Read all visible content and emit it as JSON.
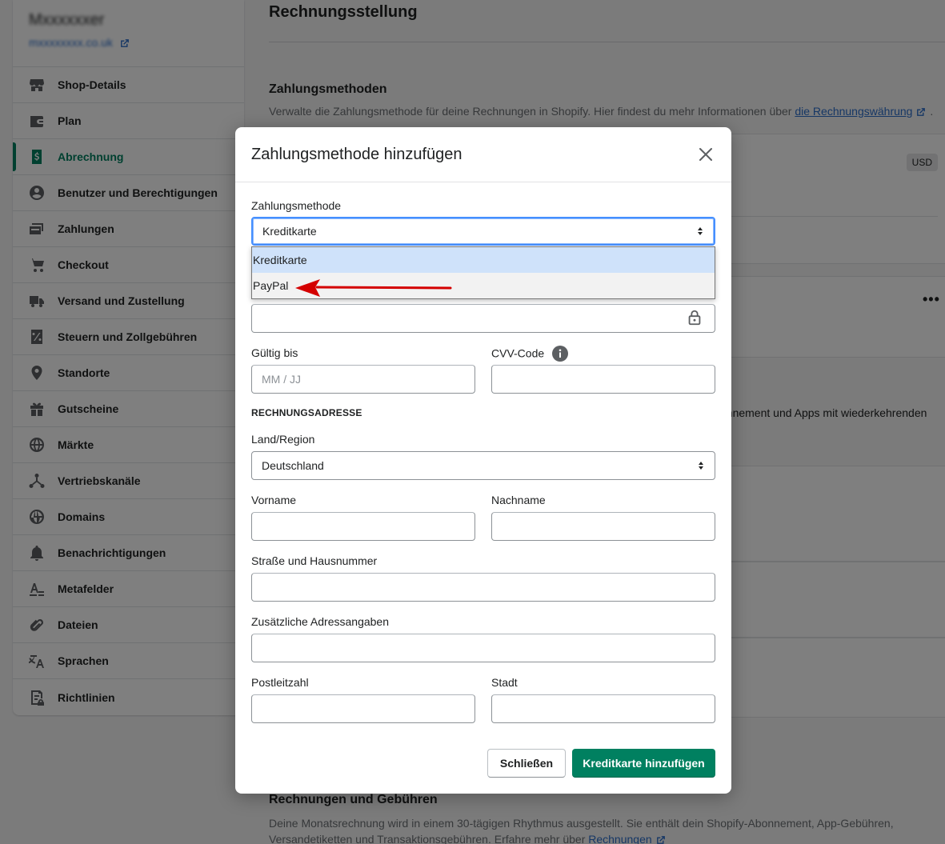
{
  "store": {
    "name": "Mxxxxxxer",
    "link": "mxxxxxxxx.co.uk"
  },
  "sidebar": {
    "items": [
      {
        "label": "Shop-Details",
        "icon": "store-icon",
        "active": false
      },
      {
        "label": "Plan",
        "icon": "plan-icon",
        "active": false
      },
      {
        "label": "Abrechnung",
        "icon": "billing-icon",
        "active": true
      },
      {
        "label": "Benutzer und Berechtigungen",
        "icon": "user-icon",
        "active": false
      },
      {
        "label": "Zahlungen",
        "icon": "payments-icon",
        "active": false
      },
      {
        "label": "Checkout",
        "icon": "cart-icon",
        "active": false
      },
      {
        "label": "Versand und Zustellung",
        "icon": "truck-icon",
        "active": false
      },
      {
        "label": "Steuern und Zollgebühren",
        "icon": "tax-icon",
        "active": false
      },
      {
        "label": "Standorte",
        "icon": "location-icon",
        "active": false
      },
      {
        "label": "Gutscheine",
        "icon": "gift-icon",
        "active": false
      },
      {
        "label": "Märkte",
        "icon": "globe-icon",
        "active": false
      },
      {
        "label": "Vertriebskanäle",
        "icon": "channels-icon",
        "active": false
      },
      {
        "label": "Domains",
        "icon": "domain-globe-icon",
        "active": false
      },
      {
        "label": "Benachrichtigungen",
        "icon": "bell-icon",
        "active": false
      },
      {
        "label": "Metafelder",
        "icon": "metafields-icon",
        "active": false
      },
      {
        "label": "Dateien",
        "icon": "paperclip-icon",
        "active": false
      },
      {
        "label": "Sprachen",
        "icon": "translate-icon",
        "active": false
      },
      {
        "label": "Richtlinien",
        "icon": "policy-icon",
        "active": false
      }
    ]
  },
  "main": {
    "title": "Rechnungsstellung",
    "payment_methods": {
      "title": "Zahlungsmethoden",
      "desc": "Verwalte die Zahlungsmethode für deine Rechnungen in Shopify. Hier findest du mehr Informationen über ",
      "link": "die Rechnungswährung",
      "desc_end": " ."
    },
    "currency_badge": "USD",
    "peek_text": "onnement und Apps mit wiederkehrenden",
    "invoices": {
      "title": "Rechnungen und Gebühren",
      "desc": "Deine Monatsrechnung wird in einem 30-tägigen Rhythmus ausgestellt. Sie enthält dein Shopify-Abonnement, App-Gebühren, Versandetiketten und Transaktionsgebühren. Erfahre mehr über ",
      "link": "Rechnungen"
    }
  },
  "modal": {
    "title": "Zahlungsmethode hinzufügen",
    "method_label": "Zahlungsmethode",
    "method_value": "Kreditkarte",
    "method_options": [
      "Kreditkarte",
      "PayPal"
    ],
    "expiry_label": "Gültig bis",
    "expiry_placeholder": "MM / JJ",
    "cvv_label": "CVV-Code",
    "billing_section": "RECHNUNGSADRESSE",
    "country_label": "Land/Region",
    "country_value": "Deutschland",
    "first_name_label": "Vorname",
    "last_name_label": "Nachname",
    "street_label": "Straße und Hausnummer",
    "address2_label": "Zusätzliche Adressangaben",
    "zip_label": "Postleitzahl",
    "city_label": "Stadt",
    "close_button": "Schließen",
    "submit_button": "Kreditkarte hinzufügen"
  },
  "colors": {
    "accent": "#008060",
    "link": "#2c6ecb",
    "annotation_arrow": "#d40000"
  }
}
